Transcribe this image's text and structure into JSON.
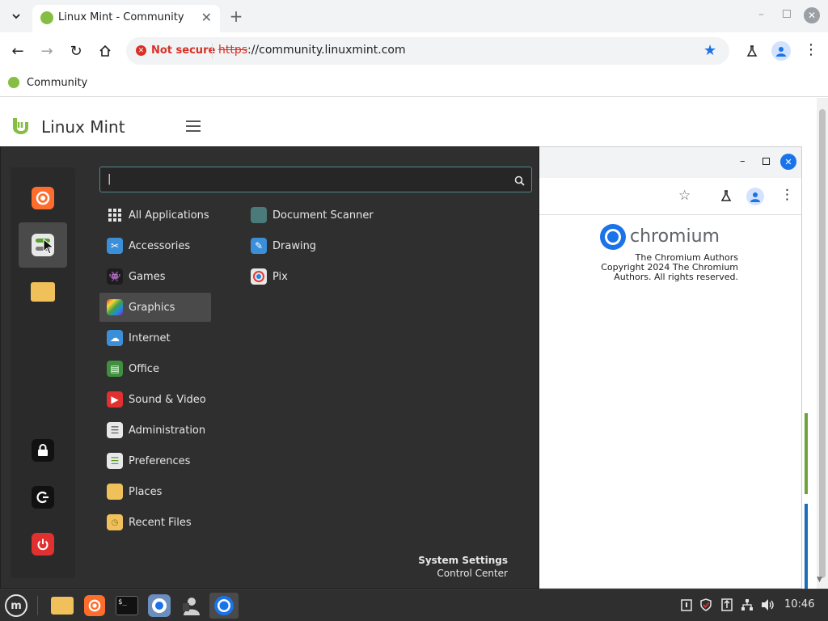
{
  "browser": {
    "tab_title": "Linux Mint - Community",
    "url_scheme": "https",
    "url_rest": "://community.linuxmint.com",
    "security_label": "Not secure",
    "bookmark_label": "Community"
  },
  "page": {
    "site_title": "Linux Mint"
  },
  "bg_window": {
    "brand": "chromium",
    "authors": "The Chromium Authors",
    "copyright_line1": "Copyright 2024 The Chromium",
    "copyright_line2": "Authors. All rights reserved."
  },
  "menu": {
    "search_value": "",
    "categories": [
      {
        "label": "All Applications",
        "icon": "grid-icon"
      },
      {
        "label": "Accessories",
        "icon": "accessories-icon"
      },
      {
        "label": "Games",
        "icon": "games-icon"
      },
      {
        "label": "Graphics",
        "icon": "graphics-icon"
      },
      {
        "label": "Internet",
        "icon": "internet-icon"
      },
      {
        "label": "Office",
        "icon": "office-icon"
      },
      {
        "label": "Sound & Video",
        "icon": "sound-video-icon"
      },
      {
        "label": "Administration",
        "icon": "administration-icon"
      },
      {
        "label": "Preferences",
        "icon": "preferences-icon"
      },
      {
        "label": "Places",
        "icon": "folder-icon"
      },
      {
        "label": "Recent Files",
        "icon": "recent-files-icon"
      }
    ],
    "apps": [
      {
        "label": "Document Scanner",
        "icon": "scanner-icon"
      },
      {
        "label": "Drawing",
        "icon": "drawing-icon"
      },
      {
        "label": "Pix",
        "icon": "pix-icon"
      }
    ],
    "footer_title": "System Settings",
    "footer_subtitle": "Control Center"
  },
  "taskbar": {
    "clock": "10:46"
  },
  "colors": {
    "mint_green": "#86be43",
    "menu_bg": "#2f2f2f",
    "accent_blue": "#1a73e8"
  }
}
